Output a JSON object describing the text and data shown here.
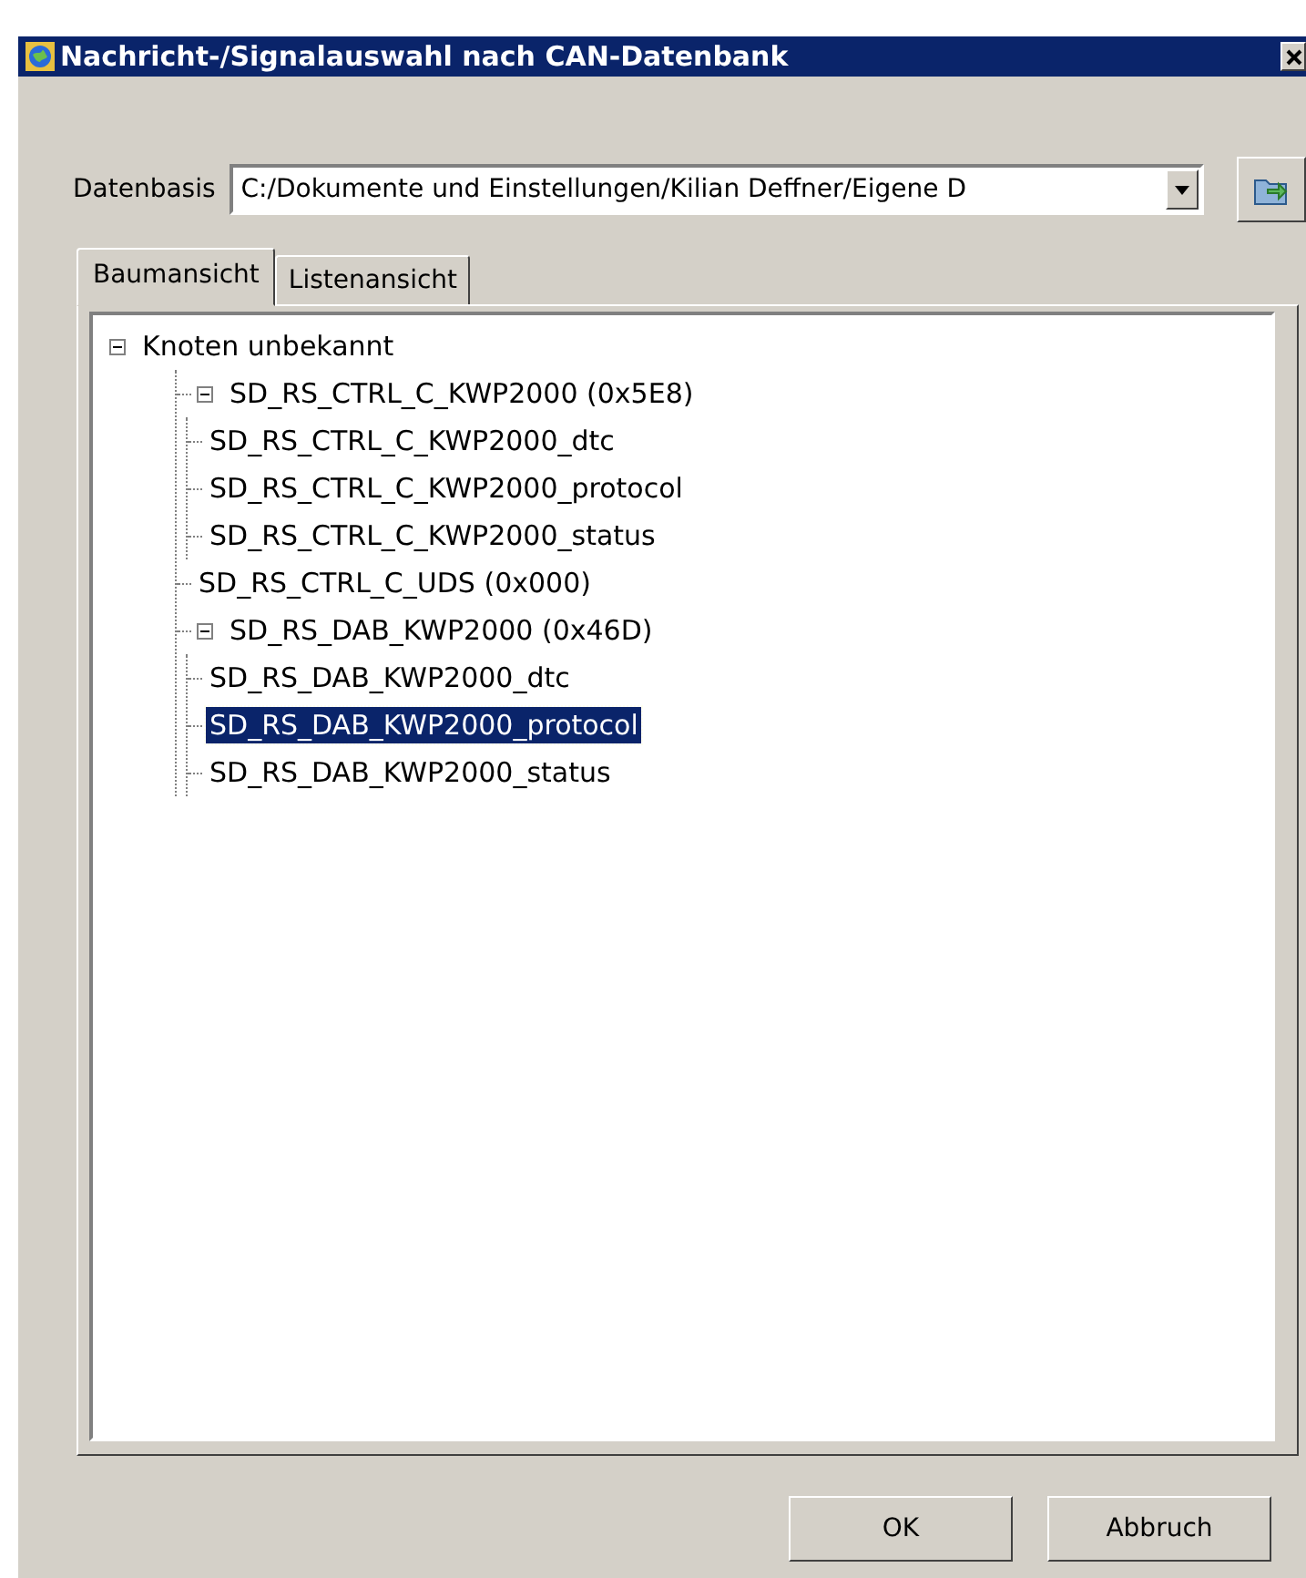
{
  "window": {
    "title": "Nachricht-/Signalauswahl nach CAN-Datenbank"
  },
  "database": {
    "label": "Datenbasis",
    "value": "C:/Dokumente und Einstellungen/Kilian Deffner/Eigene D"
  },
  "tabs": [
    {
      "label": "Baumansicht",
      "selected": true
    },
    {
      "label": "Listenansicht",
      "selected": false
    }
  ],
  "tree": [
    {
      "label": "Knoten unbekannt",
      "expanded": true,
      "selected": false,
      "children": [
        {
          "label": "SD_RS_CTRL_C_KWP2000 (0x5E8)",
          "expanded": true,
          "selected": false,
          "children": [
            {
              "label": "SD_RS_CTRL_C_KWP2000_dtc",
              "selected": false
            },
            {
              "label": "SD_RS_CTRL_C_KWP2000_protocol",
              "selected": false
            },
            {
              "label": "SD_RS_CTRL_C_KWP2000_status",
              "selected": false
            }
          ]
        },
        {
          "label": "SD_RS_CTRL_C_UDS (0x000)",
          "selected": false
        },
        {
          "label": "SD_RS_DAB_KWP2000 (0x46D)",
          "expanded": true,
          "selected": false,
          "children": [
            {
              "label": "SD_RS_DAB_KWP2000_dtc",
              "selected": false
            },
            {
              "label": "SD_RS_DAB_KWP2000_protocol",
              "selected": true
            },
            {
              "label": "SD_RS_DAB_KWP2000_status",
              "selected": false
            }
          ]
        }
      ]
    }
  ],
  "buttons": [
    "OK",
    "Abbruch"
  ]
}
